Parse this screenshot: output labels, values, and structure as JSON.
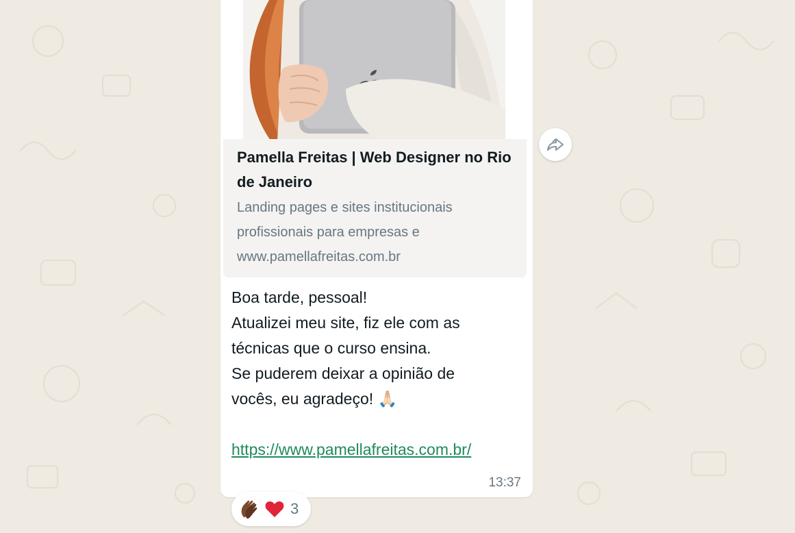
{
  "link_preview": {
    "title": "Pamella Freitas | Web Designer no Rio de Janeiro",
    "description": "Landing pages e sites institucionais profissionais para empresas e www.pamellafreitas.com.br"
  },
  "message": {
    "lines": [
      "Boa tarde, pessoal!",
      "Atualizei meu site, fiz ele com as",
      "técnicas que o curso ensina.",
      "Se puderem deixar a opinião de",
      "vocês, eu agradeço! 🙏🏻"
    ],
    "link": "https://www.pamellafreitas.com.br/",
    "time": "13:37"
  },
  "reactions": {
    "count": "3",
    "emojis": [
      "clapping-hands",
      "red-heart"
    ]
  },
  "icons": {
    "forward": "forward-arrow-icon"
  },
  "colors": {
    "background": "#efeae2",
    "bubble": "#ffffff",
    "link": "#1f8a5b",
    "heart": "#e0243a"
  }
}
